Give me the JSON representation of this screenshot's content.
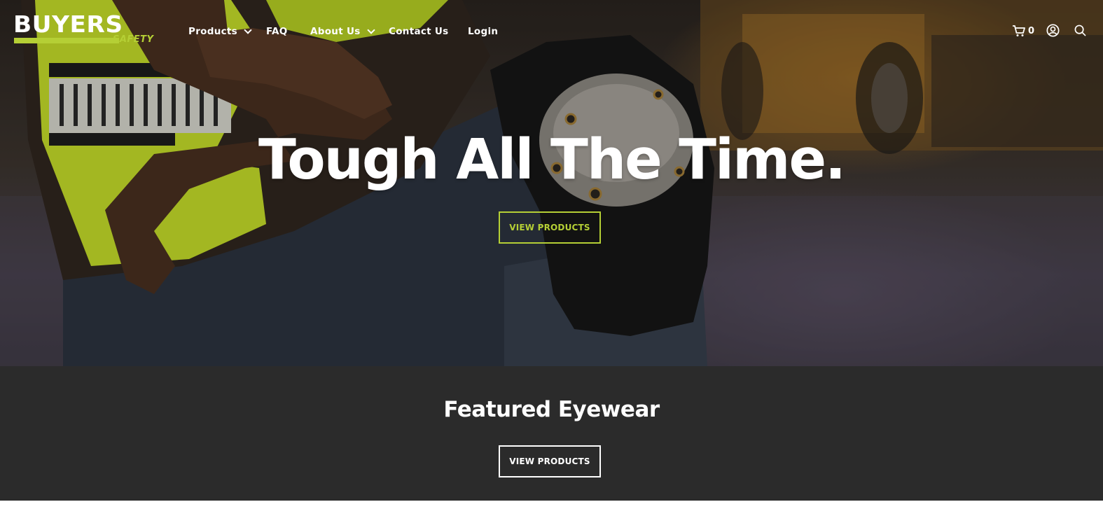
{
  "brand": {
    "name": "BUYERS",
    "tagline": "SAFETY",
    "accent_color": "#b5cf35"
  },
  "nav": {
    "items": [
      {
        "label": "Products",
        "has_dropdown": true
      },
      {
        "label": "FAQ",
        "has_dropdown": false
      },
      {
        "label": "About Us",
        "has_dropdown": true
      },
      {
        "label": "Contact Us",
        "has_dropdown": false
      },
      {
        "label": "Login",
        "has_dropdown": false
      }
    ]
  },
  "header_icons": {
    "cart_icon": "shopping-cart-icon",
    "cart_count": "0",
    "account_icon": "user-account-icon",
    "search_icon": "search-icon"
  },
  "hero": {
    "title": "Tough All The Time.",
    "button_label": "VIEW PRODUCTS"
  },
  "featured": {
    "title": "Featured Eyewear",
    "button_label": "VIEW PRODUCTS",
    "background": "#2b2b2b"
  }
}
